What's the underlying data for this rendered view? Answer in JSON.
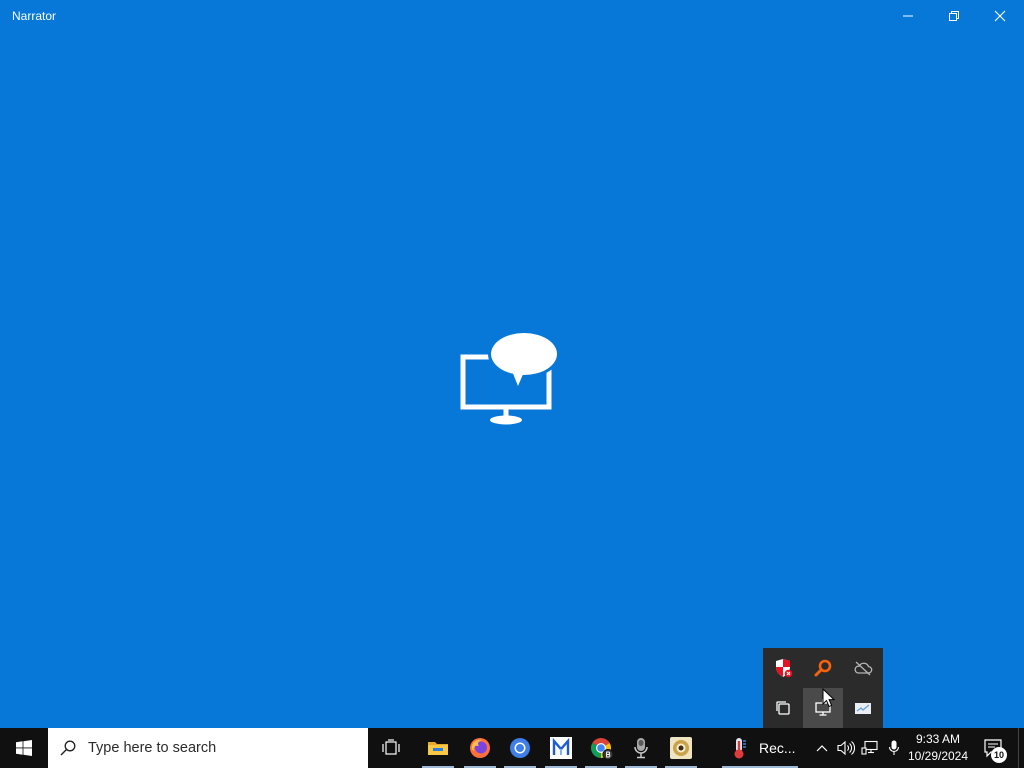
{
  "window": {
    "title": "Narrator",
    "controls": [
      {
        "icon": "minimize-icon"
      },
      {
        "icon": "restore-icon"
      },
      {
        "icon": "close-icon"
      }
    ]
  },
  "splash": {
    "icon": "narrator-icon"
  },
  "tray_overflow": {
    "items": [
      {
        "icon": "security-shield-icon"
      },
      {
        "icon": "orange-search-icon"
      },
      {
        "icon": "cloud-offline-icon"
      },
      {
        "icon": "copy-windows-icon"
      },
      {
        "icon": "monitor-icon",
        "hovered": true
      },
      {
        "icon": "mail-card-icon"
      }
    ]
  },
  "taskbar": {
    "start": {
      "icon": "windows-logo-icon"
    },
    "search": {
      "icon": "search-icon",
      "placeholder": "Type here to search"
    },
    "apps": [
      {
        "icon": "task-view-icon",
        "running": false
      },
      {
        "icon": "file-explorer-icon",
        "running": true
      },
      {
        "icon": "firefox-icon",
        "running": true
      },
      {
        "icon": "chromium-icon",
        "running": true
      },
      {
        "icon": "m-app-icon",
        "running": true
      },
      {
        "icon": "chrome-badge-icon",
        "running": true
      },
      {
        "icon": "microphone-app-icon",
        "running": true
      },
      {
        "icon": "webcam-app-icon",
        "running": true
      }
    ],
    "running_task": {
      "icon": "thermometer-icon",
      "label": "Rec..."
    },
    "tray": {
      "icons": [
        "chevron-up-icon",
        "volume-icon",
        "network-icon",
        "microphone-icon"
      ]
    },
    "clock": {
      "time": "9:33 AM",
      "date": "10/29/2024"
    },
    "notifications": {
      "icon": "action-center-icon",
      "count": "10"
    }
  },
  "colors": {
    "window_bg": "#0778d8",
    "taskbar_bg": "#101010",
    "tray_popup_bg": "#2b2b2b",
    "search_bg": "#ffffff"
  }
}
